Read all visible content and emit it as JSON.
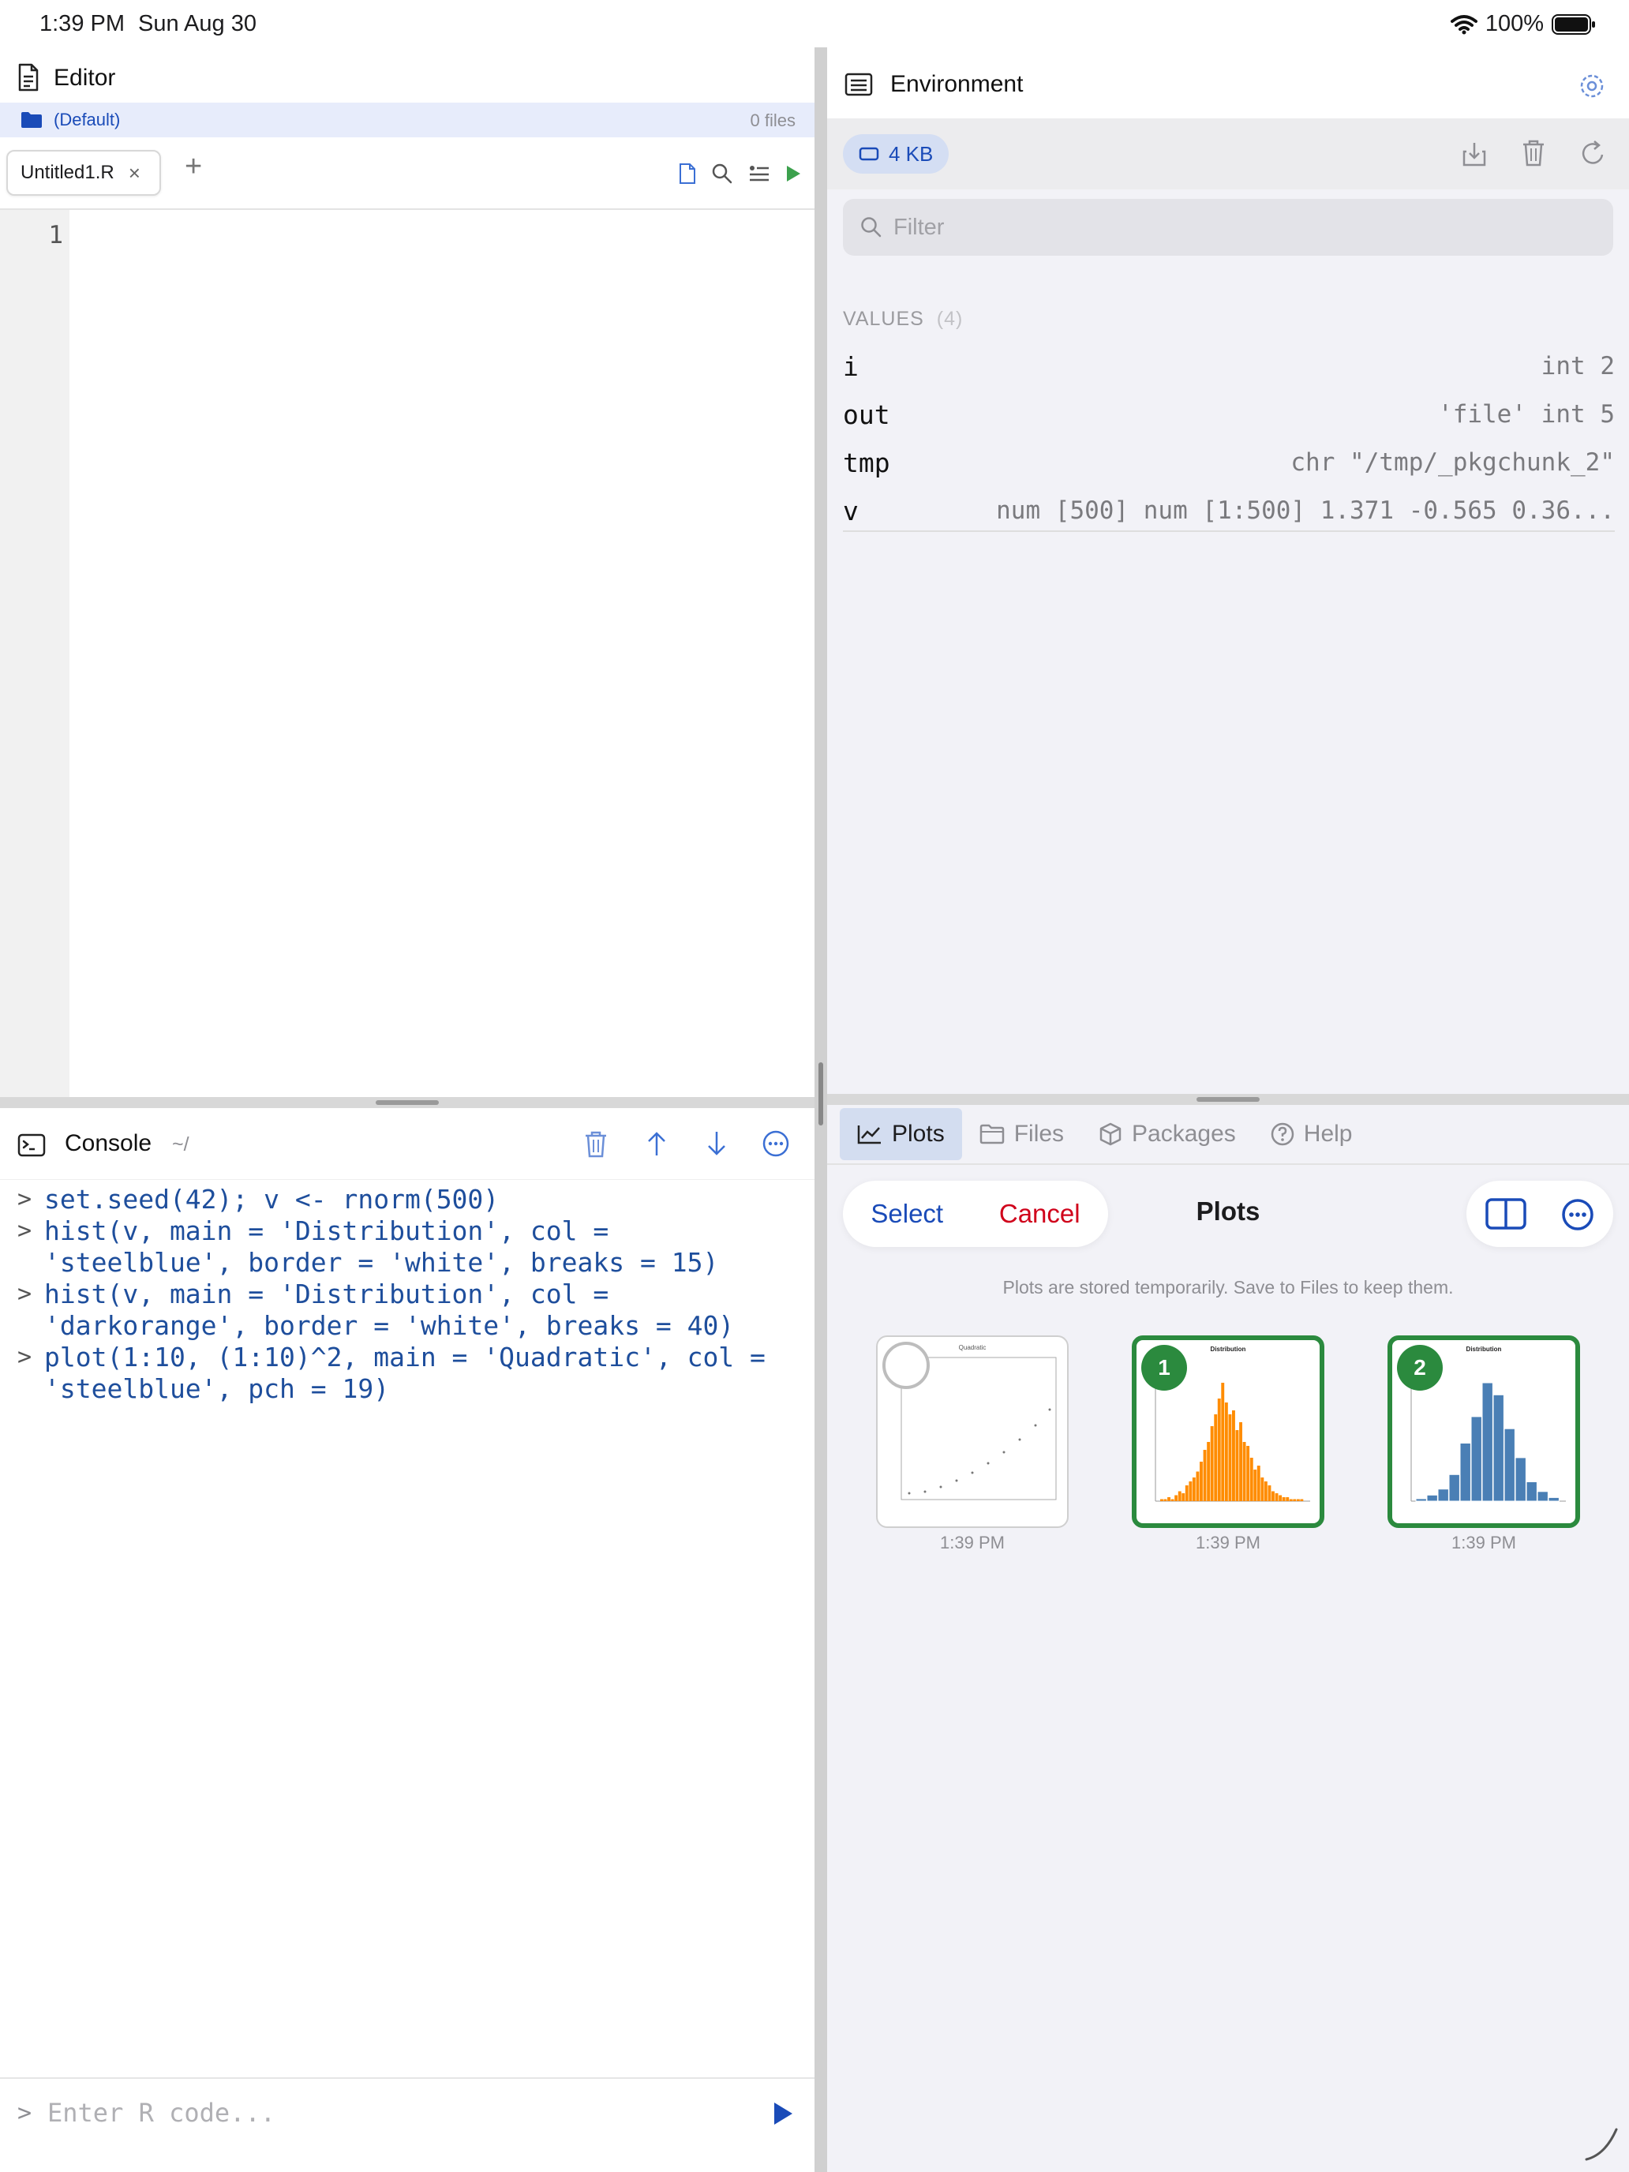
{
  "status": {
    "time": "1:39 PM",
    "date": "Sun Aug 30",
    "battery": "100%"
  },
  "editor": {
    "title": "Editor",
    "project": "(Default)",
    "file_count": "0 files",
    "tab_name": "Untitled1.R",
    "line_number": "1"
  },
  "console": {
    "title": "Console",
    "path": "~/",
    "prompt": ">",
    "lines": [
      "set.seed(42); v <- rnorm(500)",
      "hist(v, main = 'Distribution', col =\n'steelblue', border = 'white', breaks = 15)",
      "hist(v, main = 'Distribution', col =\n'darkorange', border = 'white', breaks = 40)",
      "plot(1:10, (1:10)^2, main = 'Quadratic', col =\n'steelblue', pch = 19)"
    ],
    "input_placeholder": "Enter R code..."
  },
  "environment": {
    "title": "Environment",
    "memory": "4  KB",
    "filter_placeholder": "Filter",
    "values_label": "VALUES",
    "values_count": "(4)",
    "values": [
      {
        "name": "i",
        "value": "int 2"
      },
      {
        "name": "out",
        "value": "'file' int 5"
      },
      {
        "name": "tmp",
        "value": "chr \"/tmp/_pkgchunk_2\""
      },
      {
        "name": "v",
        "value": "num [500]  num [1:500] 1.371 -0.565 0.36..."
      }
    ]
  },
  "bottom_tabs": {
    "plots": "Plots",
    "files": "Files",
    "packages": "Packages",
    "help": "Help"
  },
  "plots": {
    "select": "Select",
    "cancel": "Cancel",
    "title": "Plots",
    "note": "Plots are stored temporarily. Save to Files to keep them.",
    "thumbs": [
      {
        "title": "Quadratic",
        "time": "1:39 PM",
        "badge": ""
      },
      {
        "title": "Distribution",
        "time": "1:39 PM",
        "badge": "1"
      },
      {
        "title": "Distribution",
        "time": "1:39 PM",
        "badge": "2"
      }
    ]
  },
  "colors": {
    "accent": "#1a4bb8",
    "cancel": "#d0021b",
    "selected": "#2b8a3e",
    "orange_bars": "#ff8c00",
    "blue_bars": "#4a7fb5"
  }
}
